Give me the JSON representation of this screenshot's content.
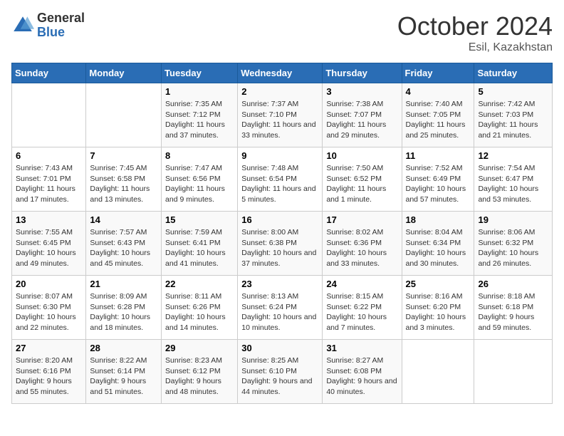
{
  "logo": {
    "general": "General",
    "blue": "Blue"
  },
  "title": {
    "month": "October 2024",
    "location": "Esil, Kazakhstan"
  },
  "days_of_week": [
    "Sunday",
    "Monday",
    "Tuesday",
    "Wednesday",
    "Thursday",
    "Friday",
    "Saturday"
  ],
  "weeks": [
    [
      {
        "day": "",
        "sunrise": "",
        "sunset": "",
        "daylight": ""
      },
      {
        "day": "",
        "sunrise": "",
        "sunset": "",
        "daylight": ""
      },
      {
        "day": "1",
        "sunrise": "Sunrise: 7:35 AM",
        "sunset": "Sunset: 7:12 PM",
        "daylight": "Daylight: 11 hours and 37 minutes."
      },
      {
        "day": "2",
        "sunrise": "Sunrise: 7:37 AM",
        "sunset": "Sunset: 7:10 PM",
        "daylight": "Daylight: 11 hours and 33 minutes."
      },
      {
        "day": "3",
        "sunrise": "Sunrise: 7:38 AM",
        "sunset": "Sunset: 7:07 PM",
        "daylight": "Daylight: 11 hours and 29 minutes."
      },
      {
        "day": "4",
        "sunrise": "Sunrise: 7:40 AM",
        "sunset": "Sunset: 7:05 PM",
        "daylight": "Daylight: 11 hours and 25 minutes."
      },
      {
        "day": "5",
        "sunrise": "Sunrise: 7:42 AM",
        "sunset": "Sunset: 7:03 PM",
        "daylight": "Daylight: 11 hours and 21 minutes."
      }
    ],
    [
      {
        "day": "6",
        "sunrise": "Sunrise: 7:43 AM",
        "sunset": "Sunset: 7:01 PM",
        "daylight": "Daylight: 11 hours and 17 minutes."
      },
      {
        "day": "7",
        "sunrise": "Sunrise: 7:45 AM",
        "sunset": "Sunset: 6:58 PM",
        "daylight": "Daylight: 11 hours and 13 minutes."
      },
      {
        "day": "8",
        "sunrise": "Sunrise: 7:47 AM",
        "sunset": "Sunset: 6:56 PM",
        "daylight": "Daylight: 11 hours and 9 minutes."
      },
      {
        "day": "9",
        "sunrise": "Sunrise: 7:48 AM",
        "sunset": "Sunset: 6:54 PM",
        "daylight": "Daylight: 11 hours and 5 minutes."
      },
      {
        "day": "10",
        "sunrise": "Sunrise: 7:50 AM",
        "sunset": "Sunset: 6:52 PM",
        "daylight": "Daylight: 11 hours and 1 minute."
      },
      {
        "day": "11",
        "sunrise": "Sunrise: 7:52 AM",
        "sunset": "Sunset: 6:49 PM",
        "daylight": "Daylight: 10 hours and 57 minutes."
      },
      {
        "day": "12",
        "sunrise": "Sunrise: 7:54 AM",
        "sunset": "Sunset: 6:47 PM",
        "daylight": "Daylight: 10 hours and 53 minutes."
      }
    ],
    [
      {
        "day": "13",
        "sunrise": "Sunrise: 7:55 AM",
        "sunset": "Sunset: 6:45 PM",
        "daylight": "Daylight: 10 hours and 49 minutes."
      },
      {
        "day": "14",
        "sunrise": "Sunrise: 7:57 AM",
        "sunset": "Sunset: 6:43 PM",
        "daylight": "Daylight: 10 hours and 45 minutes."
      },
      {
        "day": "15",
        "sunrise": "Sunrise: 7:59 AM",
        "sunset": "Sunset: 6:41 PM",
        "daylight": "Daylight: 10 hours and 41 minutes."
      },
      {
        "day": "16",
        "sunrise": "Sunrise: 8:00 AM",
        "sunset": "Sunset: 6:38 PM",
        "daylight": "Daylight: 10 hours and 37 minutes."
      },
      {
        "day": "17",
        "sunrise": "Sunrise: 8:02 AM",
        "sunset": "Sunset: 6:36 PM",
        "daylight": "Daylight: 10 hours and 33 minutes."
      },
      {
        "day": "18",
        "sunrise": "Sunrise: 8:04 AM",
        "sunset": "Sunset: 6:34 PM",
        "daylight": "Daylight: 10 hours and 30 minutes."
      },
      {
        "day": "19",
        "sunrise": "Sunrise: 8:06 AM",
        "sunset": "Sunset: 6:32 PM",
        "daylight": "Daylight: 10 hours and 26 minutes."
      }
    ],
    [
      {
        "day": "20",
        "sunrise": "Sunrise: 8:07 AM",
        "sunset": "Sunset: 6:30 PM",
        "daylight": "Daylight: 10 hours and 22 minutes."
      },
      {
        "day": "21",
        "sunrise": "Sunrise: 8:09 AM",
        "sunset": "Sunset: 6:28 PM",
        "daylight": "Daylight: 10 hours and 18 minutes."
      },
      {
        "day": "22",
        "sunrise": "Sunrise: 8:11 AM",
        "sunset": "Sunset: 6:26 PM",
        "daylight": "Daylight: 10 hours and 14 minutes."
      },
      {
        "day": "23",
        "sunrise": "Sunrise: 8:13 AM",
        "sunset": "Sunset: 6:24 PM",
        "daylight": "Daylight: 10 hours and 10 minutes."
      },
      {
        "day": "24",
        "sunrise": "Sunrise: 8:15 AM",
        "sunset": "Sunset: 6:22 PM",
        "daylight": "Daylight: 10 hours and 7 minutes."
      },
      {
        "day": "25",
        "sunrise": "Sunrise: 8:16 AM",
        "sunset": "Sunset: 6:20 PM",
        "daylight": "Daylight: 10 hours and 3 minutes."
      },
      {
        "day": "26",
        "sunrise": "Sunrise: 8:18 AM",
        "sunset": "Sunset: 6:18 PM",
        "daylight": "Daylight: 9 hours and 59 minutes."
      }
    ],
    [
      {
        "day": "27",
        "sunrise": "Sunrise: 8:20 AM",
        "sunset": "Sunset: 6:16 PM",
        "daylight": "Daylight: 9 hours and 55 minutes."
      },
      {
        "day": "28",
        "sunrise": "Sunrise: 8:22 AM",
        "sunset": "Sunset: 6:14 PM",
        "daylight": "Daylight: 9 hours and 51 minutes."
      },
      {
        "day": "29",
        "sunrise": "Sunrise: 8:23 AM",
        "sunset": "Sunset: 6:12 PM",
        "daylight": "Daylight: 9 hours and 48 minutes."
      },
      {
        "day": "30",
        "sunrise": "Sunrise: 8:25 AM",
        "sunset": "Sunset: 6:10 PM",
        "daylight": "Daylight: 9 hours and 44 minutes."
      },
      {
        "day": "31",
        "sunrise": "Sunrise: 8:27 AM",
        "sunset": "Sunset: 6:08 PM",
        "daylight": "Daylight: 9 hours and 40 minutes."
      },
      {
        "day": "",
        "sunrise": "",
        "sunset": "",
        "daylight": ""
      },
      {
        "day": "",
        "sunrise": "",
        "sunset": "",
        "daylight": ""
      }
    ]
  ]
}
